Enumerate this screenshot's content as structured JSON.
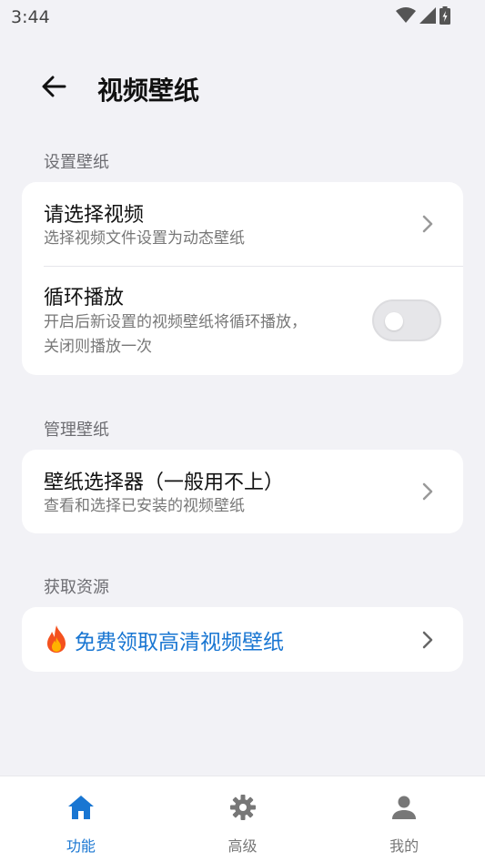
{
  "status_bar": {
    "time": "3:44"
  },
  "app_bar": {
    "title": "视频壁纸"
  },
  "sections": {
    "set": {
      "header": "设置壁纸",
      "choose_video": {
        "title": "请选择视频",
        "subtitle": "选择视频文件设置为动态壁纸"
      },
      "loop": {
        "title": "循环播放",
        "subtitle_line1": "开启后新设置的视频壁纸将循环播放，",
        "subtitle_line2": "关闭则播放一次",
        "enabled": false
      }
    },
    "manage": {
      "header": "管理壁纸",
      "picker": {
        "title": "壁纸选择器（一般用不上）",
        "subtitle": "查看和选择已安装的视频壁纸"
      }
    },
    "resources": {
      "header": "获取资源",
      "promo": {
        "icon": "fire-icon",
        "label": "免费领取高清视频壁纸"
      }
    }
  },
  "bottom_nav": {
    "items": [
      {
        "label": "功能",
        "icon": "home-icon",
        "active": true
      },
      {
        "label": "高级",
        "icon": "gear-icon",
        "active": false
      },
      {
        "label": "我的",
        "icon": "person-icon",
        "active": false
      }
    ]
  },
  "colors": {
    "accent": "#1976d2",
    "background": "#f2f2f6",
    "inactive_nav": "#777777"
  }
}
